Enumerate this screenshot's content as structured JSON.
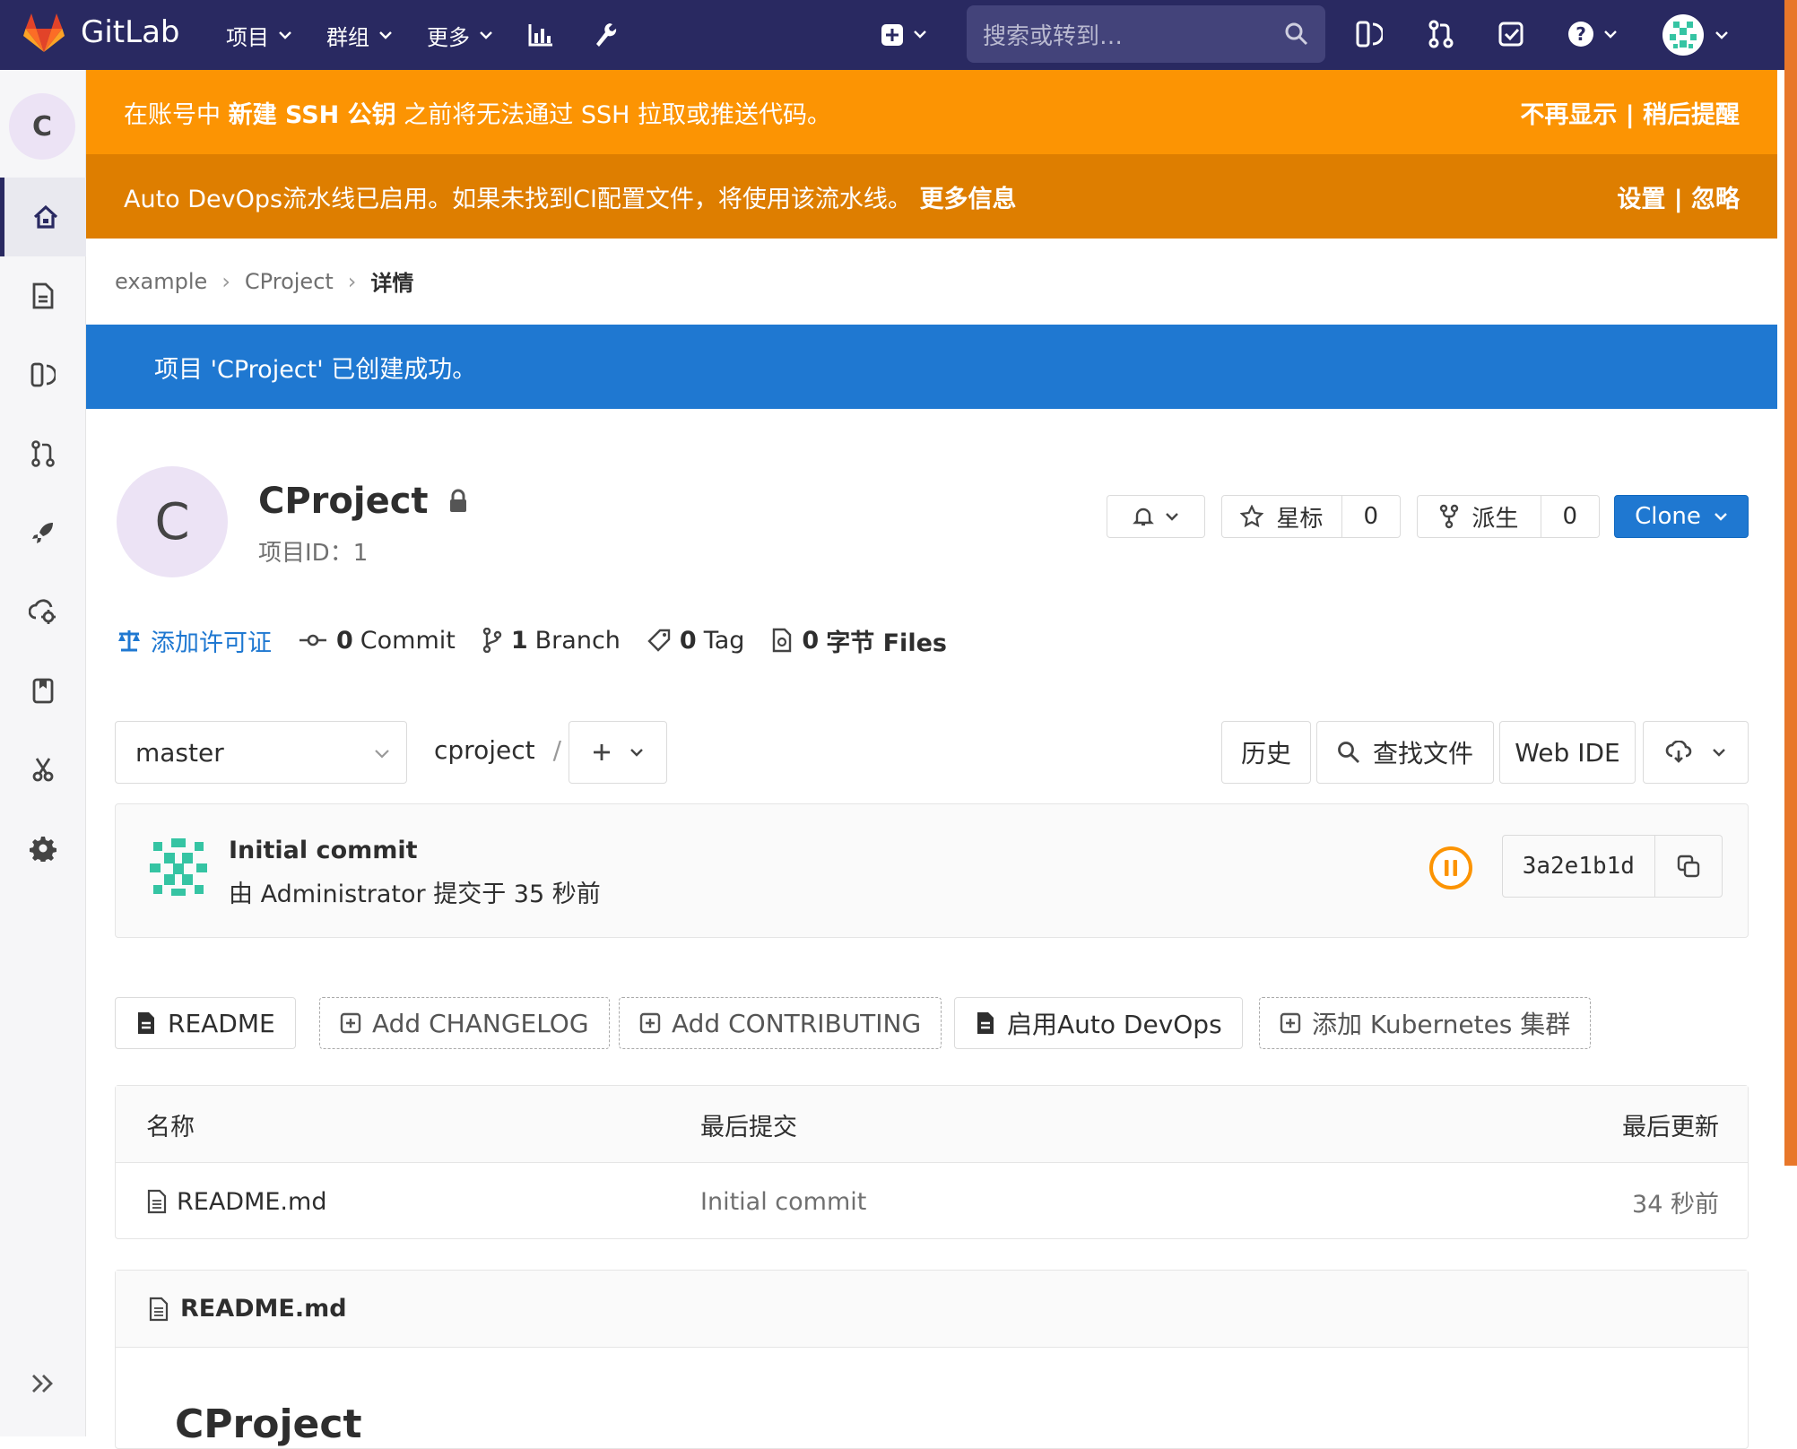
{
  "colors": {
    "topbar": "#292961",
    "warning_banner": "#fc9403",
    "devops_banner": "#de7e00",
    "flash": "#1f78d1",
    "primary": "#1f78d1"
  },
  "topbar": {
    "brand": "GitLab",
    "menu": [
      {
        "label": "项目"
      },
      {
        "label": "群组"
      },
      {
        "label": "更多"
      }
    ],
    "search_placeholder": "搜索或转到…",
    "icons": [
      "activity-chart-icon",
      "wrench-icon",
      "plus-square-icon",
      "issues-icon",
      "merge-request-icon",
      "todo-icon",
      "help-icon",
      "user-avatar-icon"
    ]
  },
  "sidebar": {
    "project_initial": "C",
    "items": [
      "home-icon",
      "repository-icon",
      "issues-icon",
      "merge-requests-icon",
      "ci-cd-rocket-icon",
      "operations-icon",
      "wiki-icon",
      "snippets-icon",
      "settings-icon"
    ],
    "collapse_icon": "double-chevron-right-icon"
  },
  "banners": {
    "ssh": {
      "prefix": "在账号中 ",
      "strong": "新建 SSH 公钥",
      "suffix": " 之前将无法通过 SSH 拉取或推送代码。",
      "actions": "不再显示 | 稍后提醒"
    },
    "devops": {
      "text": "Auto DevOps流水线已启用。如果未找到CI配置文件，将使用该流水线。 ",
      "link": "更多信息",
      "actions": "设置 | 忽略"
    }
  },
  "breadcrumb": [
    "example",
    "CProject",
    "详情"
  ],
  "flash": "项目 'CProject' 已创建成功。",
  "project": {
    "initial": "C",
    "name": "CProject",
    "id_label": "项目ID：1",
    "star_label": "星标",
    "star_count": "0",
    "fork_label": "派生",
    "fork_count": "0",
    "clone_label": "Clone"
  },
  "stats": {
    "license": "添加许可证",
    "commits_num": "0",
    "commits_label": "Commit",
    "branches_num": "1",
    "branches_label": "Branch",
    "tags_num": "0",
    "tags_label": "Tag",
    "files_num": "0",
    "files_label": "字节 Files"
  },
  "toolbar": {
    "branch": "master",
    "path": "cproject",
    "path_sep": "/",
    "history": "历史",
    "find_file": "查找文件",
    "web_ide": "Web IDE"
  },
  "commit": {
    "title": "Initial commit",
    "meta": "由 Administrator 提交于 35 秒前",
    "sha": "3a2e1b1d"
  },
  "shortcuts": [
    "README",
    "Add CHANGELOG",
    "Add CONTRIBUTING",
    "启用Auto DevOps",
    "添加 Kubernetes 集群"
  ],
  "files_table": {
    "headers": {
      "name": "名称",
      "last_commit": "最后提交",
      "last_update": "最后更新"
    },
    "rows": [
      {
        "name": "README.md",
        "commit": "Initial commit",
        "updated": "34 秒前"
      }
    ]
  },
  "readme": {
    "filename": "README.md",
    "heading": "CProject"
  }
}
